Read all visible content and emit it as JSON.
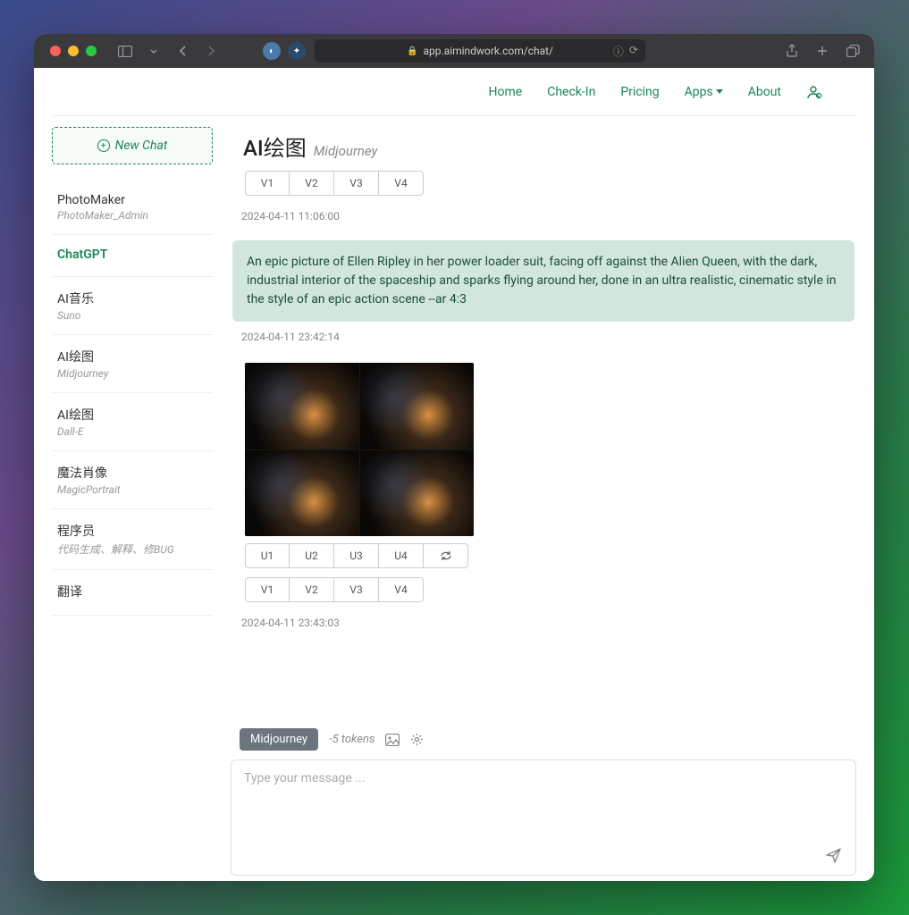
{
  "browser": {
    "url": "app.aimindwork.com/chat/"
  },
  "topnav": {
    "home": "Home",
    "checkin": "Check-In",
    "pricing": "Pricing",
    "apps": "Apps",
    "about": "About"
  },
  "sidebar": {
    "new_chat": "New Chat",
    "items": [
      {
        "title": "PhotoMaker",
        "sub": "PhotoMaker_Admin"
      },
      {
        "title": "ChatGPT",
        "sub": ""
      },
      {
        "title": "AI音乐",
        "sub": "Suno"
      },
      {
        "title": "AI绘图",
        "sub": "Midjourney"
      },
      {
        "title": "AI绘图",
        "sub": "Dall-E"
      },
      {
        "title": "魔法肖像",
        "sub": "MagicPortrait"
      },
      {
        "title": "程序员",
        "sub": "代码生成、解释、修BUG"
      },
      {
        "title": "翻译",
        "sub": ""
      }
    ]
  },
  "chat": {
    "title": "AI绘图",
    "subtitle": "Midjourney",
    "v_buttons_1": [
      "V1",
      "V2",
      "V3",
      "V4"
    ],
    "ts1": "2024-04-11 11:06:00",
    "prompt": "An epic picture of Ellen Ripley in her power loader suit, facing off against the Alien Queen, with the dark, industrial interior of the spaceship and sparks flying around her, done in an ultra realistic, cinematic style in the style of an epic action scene --ar 4:3",
    "ts2": "2024-04-11 23:42:14",
    "u_buttons": [
      "U1",
      "U2",
      "U3",
      "U4"
    ],
    "v_buttons_2": [
      "V1",
      "V2",
      "V3",
      "V4"
    ],
    "ts3": "2024-04-11 23:43:03"
  },
  "composer": {
    "model": "Midjourney",
    "tokens": "-5 tokens",
    "placeholder": "Type your message ..."
  }
}
